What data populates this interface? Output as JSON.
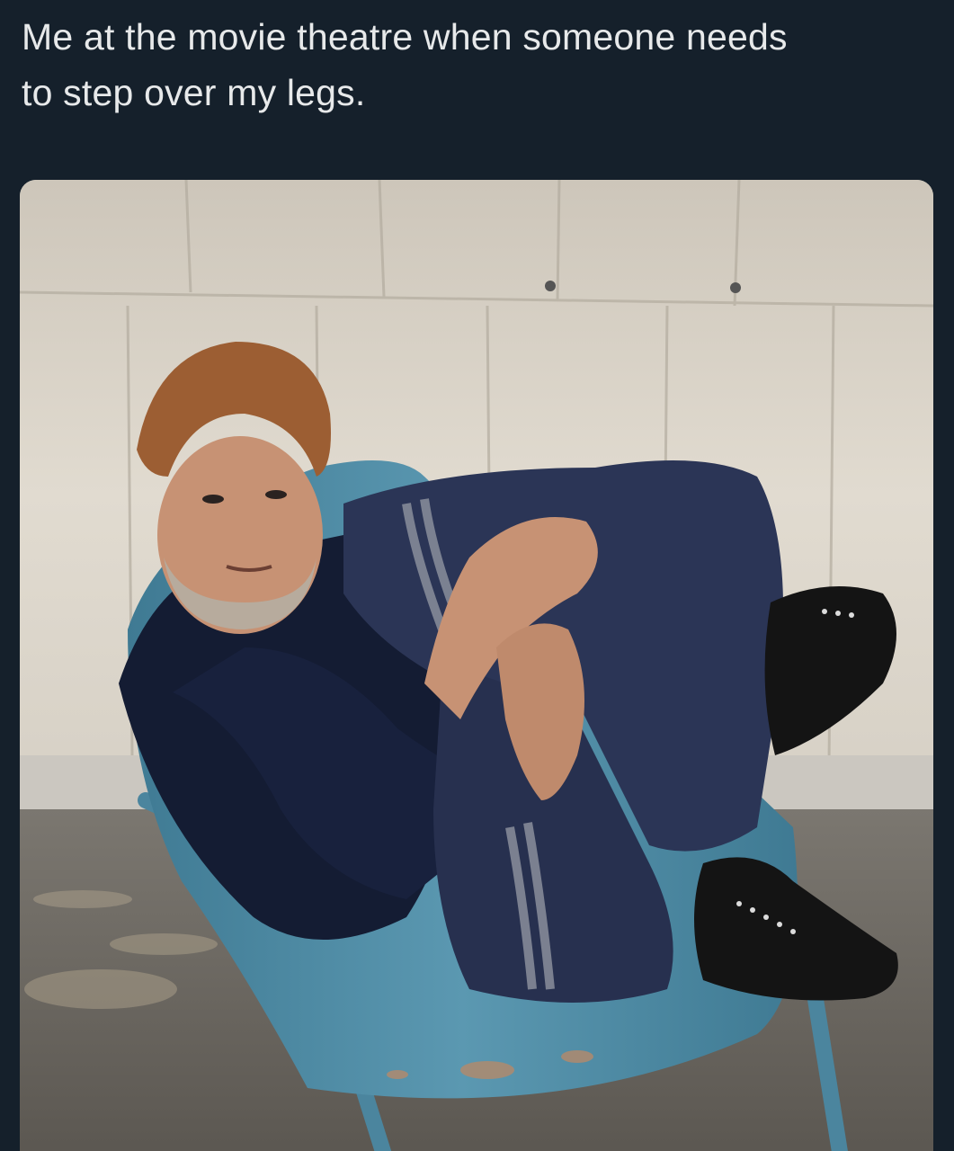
{
  "post": {
    "text": "Me at the movie theatre when someone needs\nto step over my legs."
  },
  "photo": {
    "subject": "man-in-chair",
    "colors": {
      "background": "#15202b",
      "text": "#e7e9ea",
      "wall": "#d8d2c6",
      "floor": "#6e6a63",
      "chair": "#4f8aa3",
      "sweater": "#141c33",
      "pants": "#2b3556",
      "stripe": "#8a8f9c",
      "shoe": "#141414",
      "skin": "#c79274",
      "hair": "#9c5e33",
      "beard": "#b7ab9d"
    }
  }
}
